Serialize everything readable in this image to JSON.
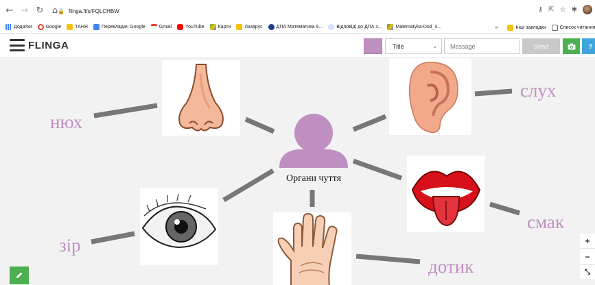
{
  "browser": {
    "url": "flinga.fi/s/FQLCHBW",
    "bookmarks": [
      "Додатки",
      "Google",
      "ТАНЯ",
      "Перекладач Google",
      "Gmail",
      "YouTube",
      "Карти",
      "Лазарус",
      "ДПА Математика 9...",
      "Відповіді до ДПА з...",
      "Matematyka-Dod_s..."
    ],
    "bookmarks_more": "»",
    "bookmarks_right": [
      "Інші закладки",
      "Список читання"
    ]
  },
  "app": {
    "brand": "FLINGA",
    "title_select": "Title",
    "message_placeholder": "Message",
    "send_label": "Send",
    "help_label": "?",
    "swatch_color": "#c08fc2"
  },
  "board": {
    "center_label": "Органи чуття",
    "words": {
      "smell": "нюх",
      "hearing": "слух",
      "taste": "смак",
      "sight": "зір",
      "touch": "дотик"
    },
    "zoom_in": "+",
    "zoom_out": "−",
    "fit": "⤡"
  },
  "colors": {
    "word": "#c08fc2",
    "connector": "#777777",
    "accent_green": "#4caf50",
    "accent_blue": "#3fa6dd"
  }
}
